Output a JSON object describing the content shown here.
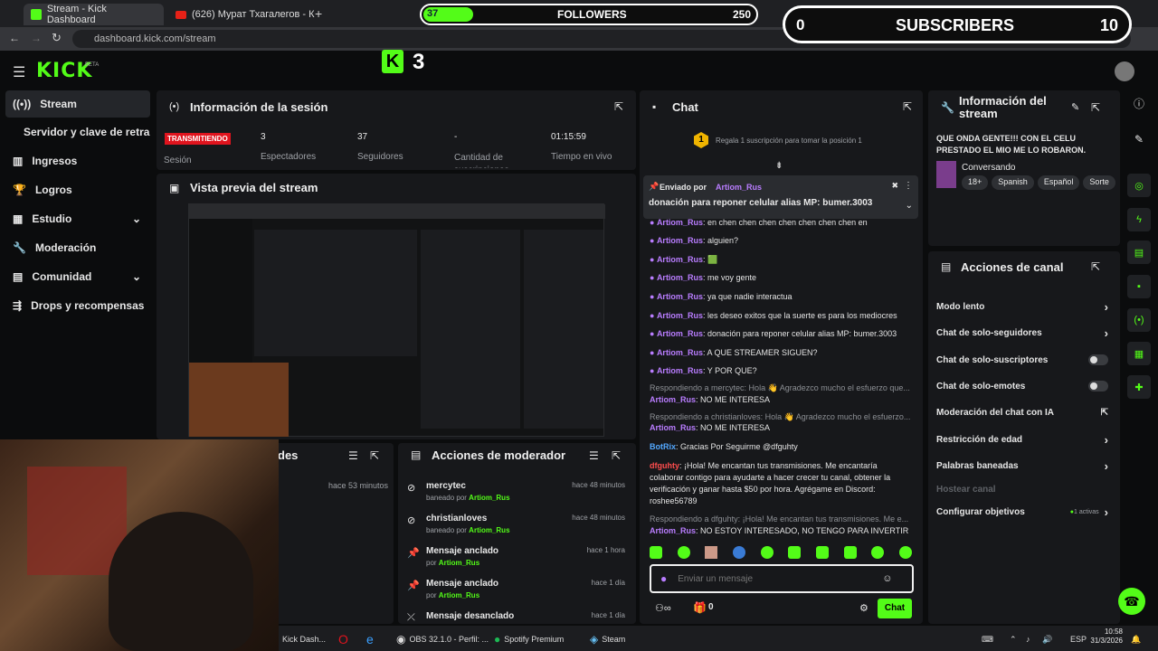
{
  "browser": {
    "tabs": [
      {
        "label": "Stream - Kick Dashboard",
        "active": true
      },
      {
        "label": "(626) Мурат Тхагалегов - К",
        "active": false
      }
    ],
    "url": "dashboard.kick.com/stream"
  },
  "overlay": {
    "followers_current": "37",
    "followers_label": "FOLLOWERS",
    "followers_goal": "250",
    "followers_progress": 0.148,
    "subs_current": "0",
    "subs_label": "SUBSCRIBERS",
    "subs_goal": "10",
    "kick_viewers": "3"
  },
  "header": {
    "logo": "KICK",
    "beta": "BETA"
  },
  "sidebar": {
    "items": [
      {
        "label": "Stream",
        "icon": "broadcast-icon"
      },
      {
        "label": "Servidor y clave de retransm",
        "icon": ""
      },
      {
        "label": "Ingresos",
        "icon": "chart-icon"
      },
      {
        "label": "Logros",
        "icon": "trophy-icon"
      },
      {
        "label": "Estudio",
        "icon": "studio-icon"
      },
      {
        "label": "Moderación",
        "icon": "wrench-icon"
      },
      {
        "label": "Comunidad",
        "icon": "community-icon"
      },
      {
        "label": "Drops y recompensas",
        "icon": "drops-icon"
      }
    ]
  },
  "session": {
    "title": "Información de la sesión",
    "status_badge": "TRANSMITIENDO",
    "status_label": "Sesión",
    "stats": [
      {
        "value": "3",
        "label": "Espectadores"
      },
      {
        "value": "37",
        "label": "Seguidores"
      },
      {
        "value": "-",
        "label": "Cantidad de suscripciones"
      },
      {
        "value": "01:15:59",
        "label": "Tiempo en vivo"
      }
    ]
  },
  "preview": {
    "title": "Vista previa del stream"
  },
  "bottom_left": {
    "title_fragment": "des",
    "time": "hace 53 minutos"
  },
  "mod_actions": {
    "title": "Acciones de moderador",
    "rows": [
      {
        "title": "mercytec",
        "sub_prefix": "baneado por",
        "sub_user": "Artiom_Rus",
        "time": "hace 48 minutos",
        "icon": "ban-icon"
      },
      {
        "title": "christianloves",
        "sub_prefix": "baneado por",
        "sub_user": "Artiom_Rus",
        "time": "hace 48 minutos",
        "icon": "ban-icon"
      },
      {
        "title": "Mensaje anclado",
        "sub_prefix": "por",
        "sub_user": "Artiom_Rus",
        "time": "hace 1 hora",
        "icon": "pin-icon"
      },
      {
        "title": "Mensaje anclado",
        "sub_prefix": "por",
        "sub_user": "Artiom_Rus",
        "time": "hace 1 día",
        "icon": "pin-icon"
      },
      {
        "title": "Mensaje desanclado",
        "sub_prefix": "",
        "sub_user": "",
        "time": "hace 1 día",
        "icon": "unpin-icon"
      }
    ]
  },
  "chat": {
    "title": "Chat",
    "gift_rank": "1",
    "gift_text": "Regala 1 suscripción para tomar la posición 1",
    "pinned_by_label": "Enviado por",
    "pinned_by_user": "Artiom_Rus",
    "pinned_message": "donación para reponer celular alias MP: bumer.3003",
    "messages": [
      {
        "user": "Artiom_Rus",
        "text": "en chen chen chen chen chen chen chen en"
      },
      {
        "user": "Artiom_Rus",
        "text": "alguien?"
      },
      {
        "user": "Artiom_Rus",
        "text": "🟩"
      },
      {
        "user": "Artiom_Rus",
        "text": "me voy gente"
      },
      {
        "user": "Artiom_Rus",
        "text": "ya que nadie interactua"
      },
      {
        "user": "Artiom_Rus",
        "text": "les deseo exitos que la suerte es para los mediocres"
      },
      {
        "user": "Artiom_Rus",
        "text": "donación para reponer celular alias MP: bumer.3003"
      },
      {
        "user": "Artiom_Rus",
        "text": "A QUE STREAMER SIGUEN?"
      },
      {
        "user": "Artiom_Rus",
        "text": "Y POR QUE?"
      }
    ],
    "reply1": "Respondiendo a mercytec: Hola 👋 Agradezco mucho el esfuerzo que...",
    "reply1_user": "Artiom_Rus",
    "reply1_text": "NO ME INTERESA",
    "reply2": "Respondiendo a christianloves: Hola 👋 Agradezco mucho el esfuerzo...",
    "reply2_user": "Artiom_Rus",
    "reply2_text": "NO ME INTERESA",
    "bot_user": "BotRix",
    "bot_text": "Gracias Por Seguirme @dfguhty",
    "spam_user": "dfguhty",
    "spam_text": "¡Hola! Me encantan tus transmisiones. Me encantaría colaborar contigo para ayudarte a hacer crecer tu canal, obtener la verificación y ganar hasta $50 por hora. Agrégame en Discord: roshee56789",
    "reply3": "Respondiendo a dfguhty: ¡Hola! Me encantan tus transmisiones. Me e...",
    "reply3_user": "Artiom_Rus",
    "reply3_text": "NO ESTOY INTERESADO, NO TENGO PARA INVERTIR",
    "input_placeholder": "Enviar un mensaje",
    "points": "0",
    "send_label": "Chat"
  },
  "stream_info": {
    "title": "Información del stream",
    "stream_title": "QUE ONDA GENTE!!! CON EL CELU PRESTADO EL MIO ME LO ROBARON.",
    "category": "Conversando",
    "tags": [
      "18+",
      "Spanish",
      "Español",
      "Sorte"
    ]
  },
  "channel_actions": {
    "title": "Acciones de canal",
    "items": [
      {
        "label": "Modo lento",
        "control": "arrow"
      },
      {
        "label": "Chat de solo-seguidores",
        "control": "arrow"
      },
      {
        "label": "Chat de solo-suscriptores",
        "control": "toggle"
      },
      {
        "label": "Chat de solo-emotes",
        "control": "toggle"
      },
      {
        "label": "Moderación del chat con IA",
        "control": "external"
      },
      {
        "label": "Restricción de edad",
        "control": "arrow"
      },
      {
        "label": "Palabras baneadas",
        "control": "arrow"
      },
      {
        "label": "Hostear canal",
        "control": "disabled"
      },
      {
        "label": "Configurar objetivos",
        "control": "arrow",
        "badge": "1 activas"
      }
    ]
  },
  "taskbar": {
    "items": [
      "Kick Dash...",
      "OBS 32.1.0 - Perfil: ...",
      "Spotify Premium",
      "Steam"
    ],
    "lang": "ESP",
    "time": "10:58",
    "date": "31/3/2026"
  },
  "colors": {
    "accent": "#53fc18",
    "username": "#b97dff",
    "live": "#e0141e"
  }
}
